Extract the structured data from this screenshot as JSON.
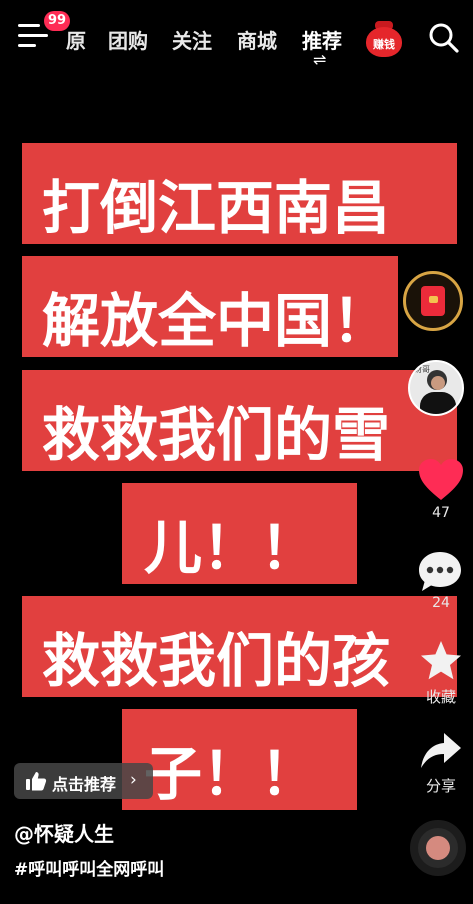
{
  "topbar": {
    "notification_count": "99",
    "tabs": [
      "原",
      "团购",
      "关注",
      "商城",
      "推荐"
    ],
    "active_tab_switch_icon": "⇌",
    "earn_label": "赚钱"
  },
  "video": {
    "lines": [
      "打倒江西南昌",
      "解放全中国！",
      "救救我们的雪",
      "儿！！",
      "救救我们的孩",
      "子！！"
    ],
    "text_block_color": "#e1403f"
  },
  "rail": {
    "like_count": "47",
    "comment_count": "24",
    "favorite_label": "收藏",
    "share_label": "分享",
    "avatar_tag": "财哥"
  },
  "info": {
    "recommend_label": "点击推荐",
    "author": "@怀疑人生",
    "hashtag": "#呼叫呼叫全网呼叫"
  },
  "colors": {
    "accent": "#fe2c55",
    "like_color": "#fe2c55",
    "background": "#000000"
  }
}
